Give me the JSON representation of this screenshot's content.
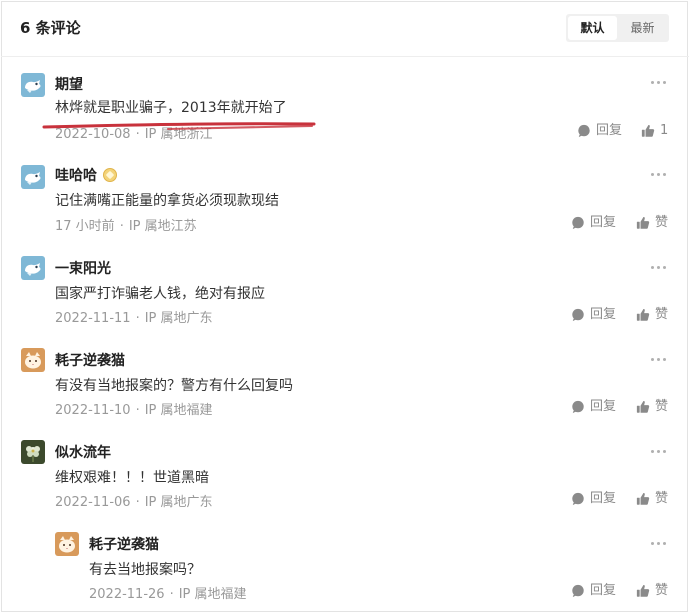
{
  "header": {
    "count_title": "6 条评论",
    "sort_default": "默认",
    "sort_newest": "最新"
  },
  "comments": [
    {
      "username": "期望",
      "text": "林烨就是职业骗子，2013年就开始了",
      "date": "2022-10-08",
      "ip": "IP 属地浙江",
      "reply_label": "回复",
      "like_label": "1",
      "avatar": "bird-avatar"
    },
    {
      "username": "哇哈哈",
      "text": "记住满嘴正能量的拿货必须现款现结",
      "date": "17 小时前",
      "ip": "IP 属地江苏",
      "reply_label": "回复",
      "like_label": "赞",
      "avatar": "bird-avatar",
      "badge": "level-badge-icon"
    },
    {
      "username": "一束阳光",
      "text": "国家严打诈骗老人钱，绝对有报应",
      "date": "2022-11-11",
      "ip": "IP 属地广东",
      "reply_label": "回复",
      "like_label": "赞",
      "avatar": "bird-avatar"
    },
    {
      "username": "耗子逆袭猫",
      "text": "有没有当地报案的？警方有什么回复吗",
      "date": "2022-11-10",
      "ip": "IP 属地福建",
      "reply_label": "回复",
      "like_label": "赞",
      "avatar": "cat-avatar"
    },
    {
      "username": "似水流年",
      "text": "维权艰难！！！世道黑暗",
      "date": "2022-11-06",
      "ip": "IP 属地广东",
      "reply_label": "回复",
      "like_label": "赞",
      "avatar": "flower-avatar"
    },
    {
      "username": "耗子逆袭猫",
      "text": "有去当地报案吗？",
      "date": "2022-11-26",
      "ip": "IP 属地福建",
      "reply_label": "回复",
      "like_label": "赞",
      "avatar": "cat-avatar"
    }
  ],
  "icons": {
    "more": "more-dots-icon",
    "reply": "reply-bubble-icon",
    "like": "thumbs-up-icon"
  },
  "colors": {
    "annotation_underline": "#c8323c",
    "meta_text": "#999999",
    "action_icon": "#8a8a8a"
  }
}
